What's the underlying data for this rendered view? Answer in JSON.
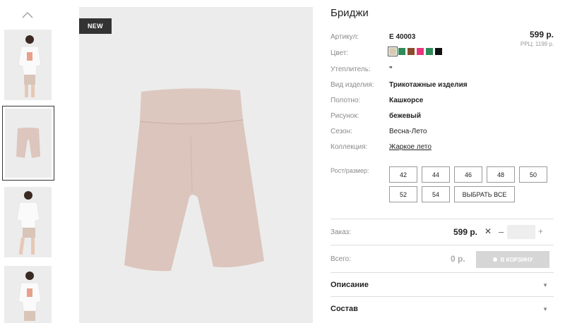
{
  "badge": "NEW",
  "title": "Бриджи",
  "price": "599 р.",
  "rrp": "РРЦ: 1199 р.",
  "details": [
    {
      "label": "Артикул:",
      "value": "E 40003",
      "bold": true
    },
    {
      "label": "Цвет:",
      "value": ""
    },
    {
      "label": "Утеплитель:",
      "value": "\"",
      "bold": true
    },
    {
      "label": "Вид изделия:",
      "value": "Трикотажные изделия",
      "bold": true
    },
    {
      "label": "Полотно:",
      "value": "Кашкорсе",
      "bold": true
    },
    {
      "label": "Рисунок:",
      "value": "бежевый",
      "bold": true
    },
    {
      "label": "Сезон:",
      "value": "Весна-Лето",
      "bold": false
    },
    {
      "label": "Коллекция:",
      "value": "Жаркое лето",
      "bold": false
    }
  ],
  "colors": [
    "#d8cbb0",
    "#2e8b57",
    "#8b4a2b",
    "#e8357a",
    "#2e8b57",
    "#111111"
  ],
  "size_label": "Рост/размер:",
  "sizes": [
    "42",
    "44",
    "46",
    "48",
    "50",
    "52",
    "54"
  ],
  "select_all": "ВЫБРАТЬ ВСЕ",
  "order_label": "Заказ:",
  "order_price": "599 р.",
  "x_mark": "✕",
  "minus": "–",
  "plus": "+",
  "qty_value": "",
  "total_label": "Всего:",
  "total_value": "0 р.",
  "cart_label": "В КОРЗИНУ",
  "accordions": [
    "Описание",
    "Состав"
  ]
}
